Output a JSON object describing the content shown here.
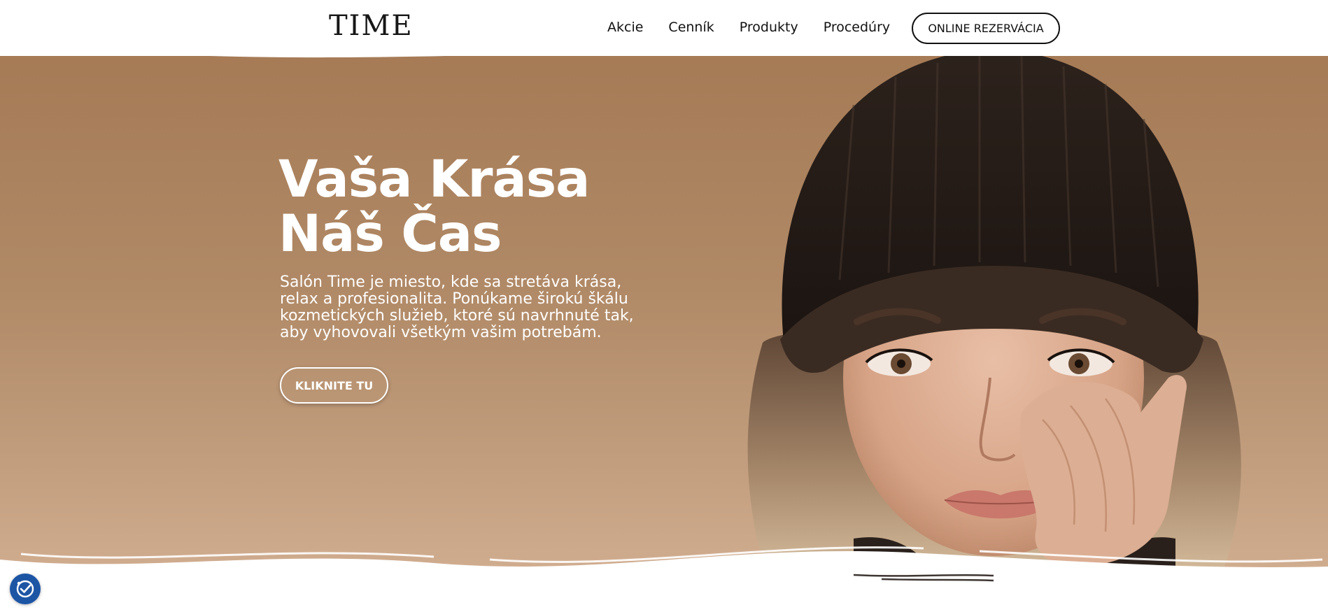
{
  "header": {
    "logo": "TIME",
    "nav": [
      "Akcie",
      "Cenník",
      "Produkty",
      "Procedúry"
    ],
    "cta_label": "ONLINE REZERVÁCIA"
  },
  "hero": {
    "title_line1": "Vaša Krása",
    "title_line2": "Náš Čas",
    "subtitle_lines": [
      "Salón Time je miesto, kde sa stretáva krása,",
      "relax a profesionalita. Ponúkame širokú škálu",
      "kozmetických služieb, ktoré sú navrhnuté tak,",
      "aby vyhovovali všetkým vašim potrebám."
    ],
    "button_label": "KLIKNITE TU",
    "image": "portrait of a woman in a dark knit hat"
  },
  "accessibility": {
    "icon": "accessibility-check-icon"
  },
  "colors": {
    "hero_top": "#a57a55",
    "hero_bottom": "#d2ae91",
    "text_light": "#ffffff",
    "text_dark": "#111111",
    "accessibility_blue": "#1d55a5"
  }
}
